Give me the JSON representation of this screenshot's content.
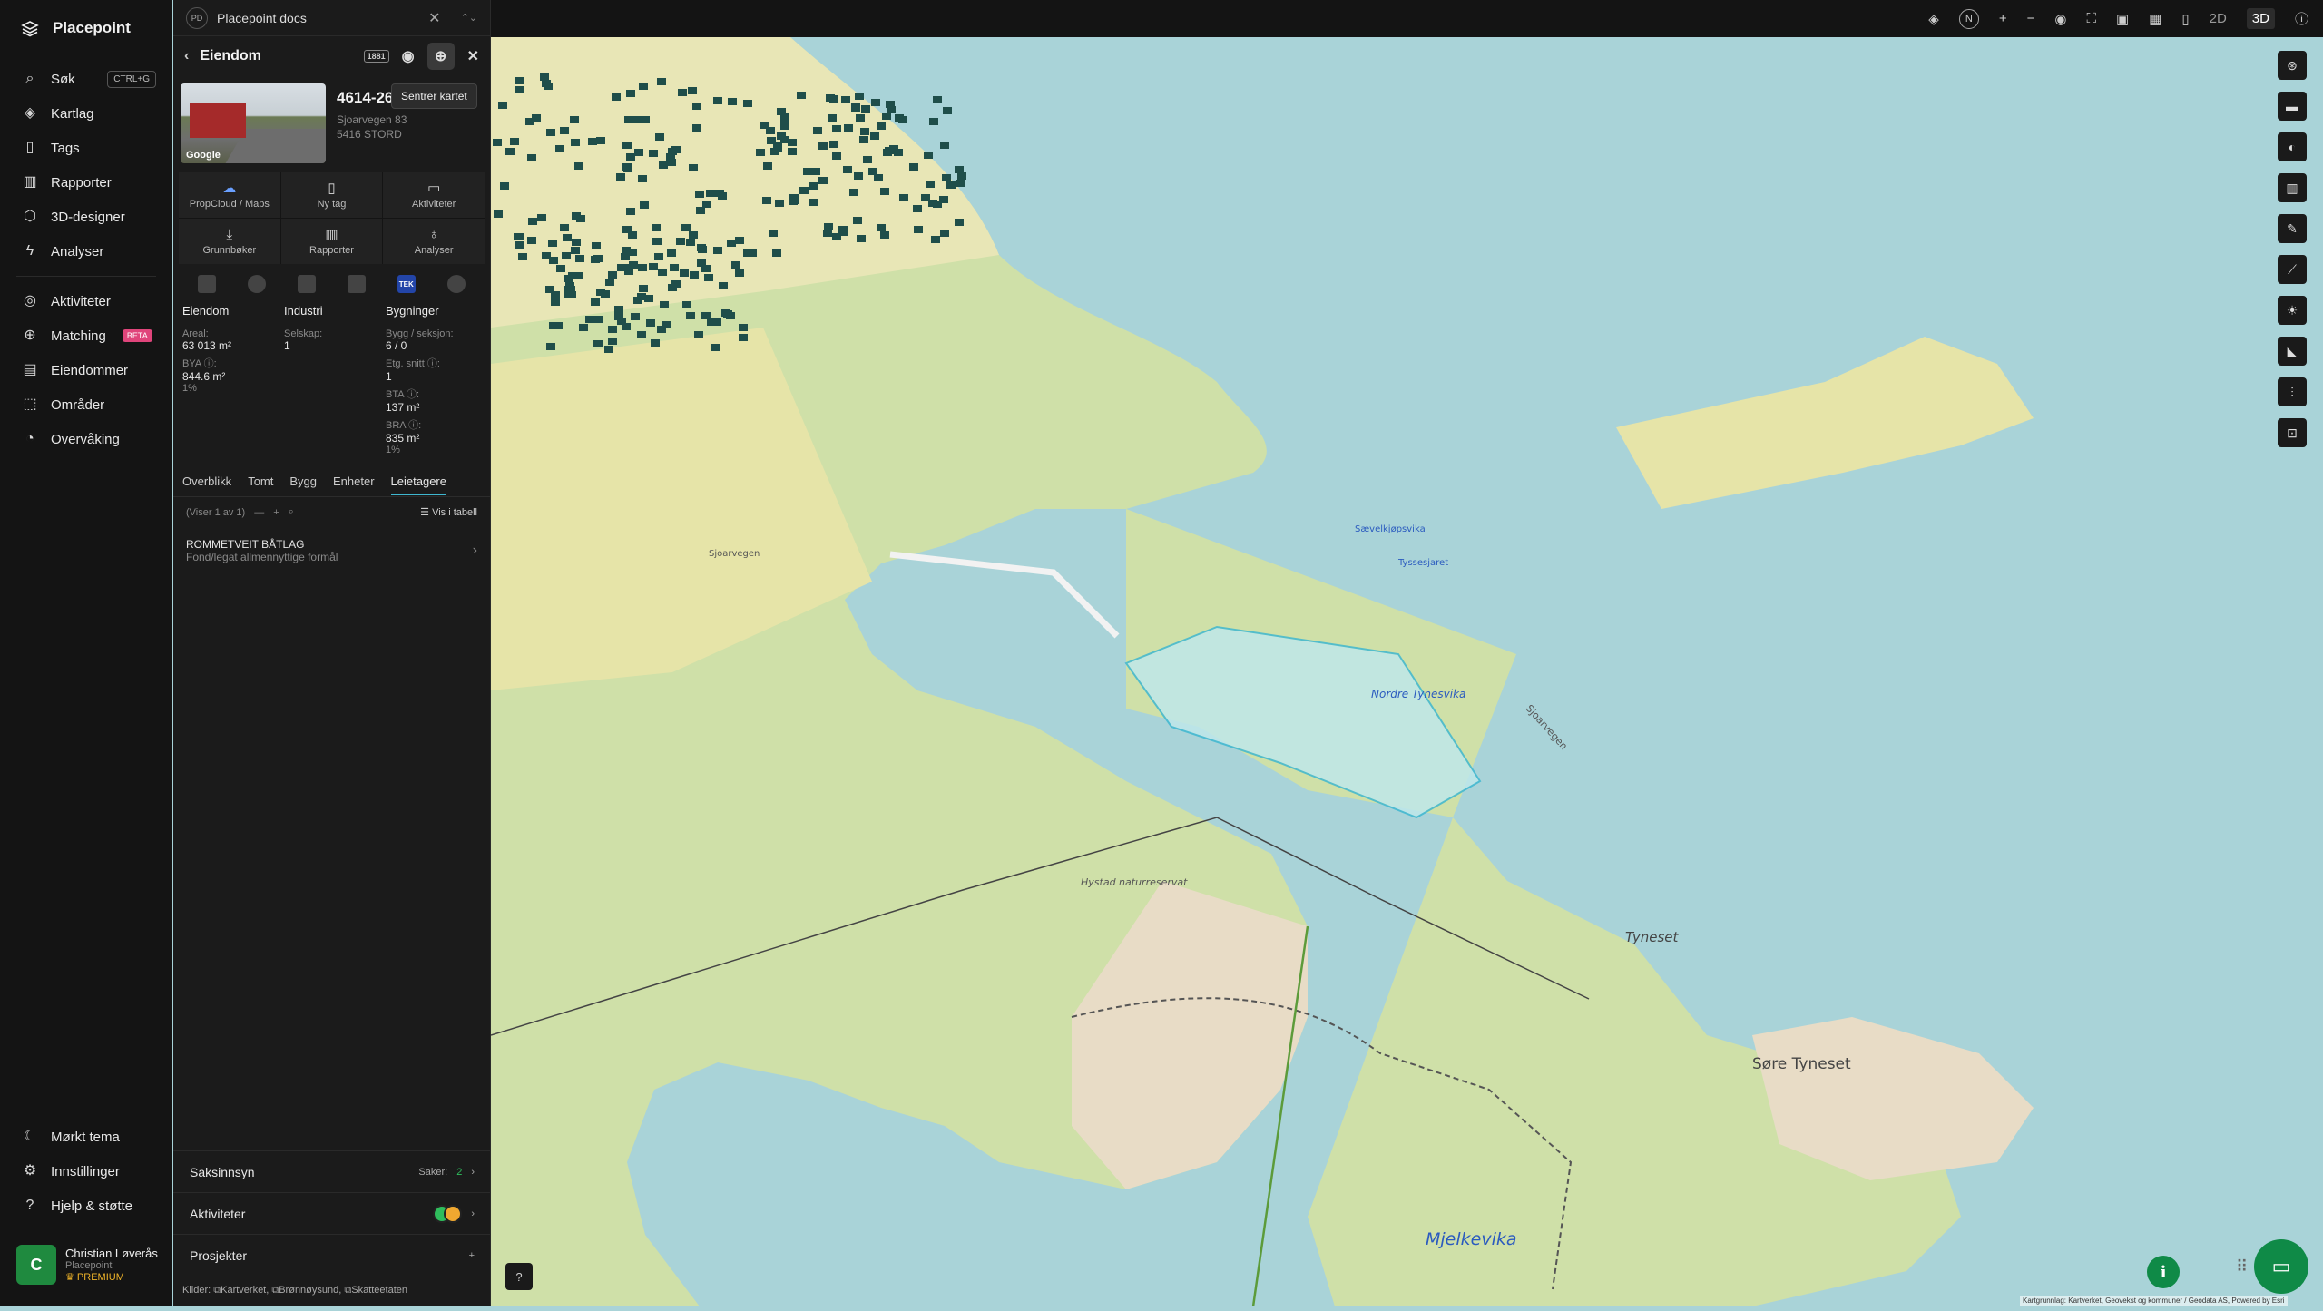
{
  "app": {
    "name": "Placepoint"
  },
  "nav": {
    "items": [
      {
        "icon": "search-icon",
        "label": "Søk",
        "shortcut": "CTRL+G"
      },
      {
        "icon": "layers-icon",
        "label": "Kartlag"
      },
      {
        "icon": "bookmark-icon",
        "label": "Tags"
      },
      {
        "icon": "bar-chart-icon",
        "label": "Rapporter"
      },
      {
        "icon": "cube-icon",
        "label": "3D-designer"
      },
      {
        "icon": "bolt-icon",
        "label": "Analyser"
      }
    ],
    "items2": [
      {
        "icon": "activity-icon",
        "label": "Aktiviteter"
      },
      {
        "icon": "matching-icon",
        "label": "Matching",
        "badge": "BETA"
      },
      {
        "icon": "building-icon",
        "label": "Eiendommer"
      },
      {
        "icon": "area-icon",
        "label": "Områder"
      },
      {
        "icon": "monitor-icon",
        "label": "Overvåking"
      }
    ],
    "bottom": [
      {
        "icon": "moon-icon",
        "label": "Mørkt tema"
      },
      {
        "icon": "gear-icon",
        "label": "Innstillinger"
      },
      {
        "icon": "help-icon",
        "label": "Hjelp & støtte"
      }
    ],
    "user": {
      "initial": "C",
      "name": "Christian Løverås",
      "org": "Placepoint",
      "plan": "PREMIUM"
    }
  },
  "docs": {
    "badge": "PD",
    "title": "Placepoint docs"
  },
  "panel": {
    "title": "Eiendom",
    "tag": "1881",
    "tooltip": "Sentrer kartet",
    "property": {
      "id": "4614-26-389-0-0",
      "street": "Sjoarvegen 83",
      "city": "5416 STORD",
      "photo_credit": "Google"
    },
    "actions": [
      {
        "icon": "cloud-icon",
        "label": "PropCloud / Maps"
      },
      {
        "icon": "bookmark-icon",
        "label": "Ny tag"
      },
      {
        "icon": "chat-icon",
        "label": "Aktiviteter"
      },
      {
        "icon": "download-icon",
        "label": "Grunnbøker"
      },
      {
        "icon": "chart-icon",
        "label": "Rapporter"
      },
      {
        "icon": "bulb-icon",
        "label": "Analyser"
      }
    ],
    "tek": "TEK",
    "eiendom": {
      "title": "Eiendom",
      "areal_label": "Areal:",
      "areal": "63 013 m²",
      "bya_label": "BYA ⓘ:",
      "bya": "844.6 m²",
      "bya_pct": "1%"
    },
    "industri": {
      "title": "Industri",
      "selskap_label": "Selskap:",
      "selskap": "1"
    },
    "bygninger": {
      "title": "Bygninger",
      "bygg_label": "Bygg / seksjon:",
      "bygg": "6 / 0",
      "etg_label": "Etg. snitt ⓘ:",
      "etg": "1",
      "bta_label": "BTA ⓘ:",
      "bta": "137 m²",
      "bra_label": "BRA ⓘ:",
      "bra": "835 m²",
      "bra_pct": "1%"
    },
    "tabs": [
      "Overblikk",
      "Tomt",
      "Bygg",
      "Enheter",
      "Leietagere"
    ],
    "active_tab": "Leietagere",
    "list": {
      "count": "(Viser 1 av 1)",
      "table_link": "Vis i tabell"
    },
    "tenant": {
      "name": "ROMMETVEIT BÅTLAG",
      "type": "Fond/legat allmennyttige formål"
    },
    "saksinnsyn": {
      "label": "Saksinnsyn",
      "cases_label": "Saker:",
      "cases": "2"
    },
    "aktiviteter": {
      "label": "Aktiviteter"
    },
    "prosjekter": {
      "label": "Prosjekter",
      "add": "+"
    },
    "sources": {
      "prefix": "Kilder:",
      "items": [
        "Kartverket,",
        "Brønnøysund,",
        "Skatteetaten"
      ]
    }
  },
  "topbar": {
    "north": "N",
    "plus": "+",
    "minus": "−",
    "mode2d": "2D",
    "mode3d": "3D",
    "active_mode": "3D"
  },
  "map": {
    "labels": [
      "Sævelkjøpsvika",
      "Tyssesjaret",
      "Nordre Tynesvika",
      "Sjoarvegen",
      "Hystad naturreservat",
      "Tyneset",
      "Søre Tyneset",
      "Mjelkevika",
      "Sjoarvegen"
    ],
    "attribution": "Kartgrunnlag: Kartverket, Geovekst og kommuner / Geodata AS, Powered by Esri"
  },
  "colors": {
    "accent": "#3fb7d0",
    "green": "#0f8a47",
    "beta": "#e0457b"
  }
}
